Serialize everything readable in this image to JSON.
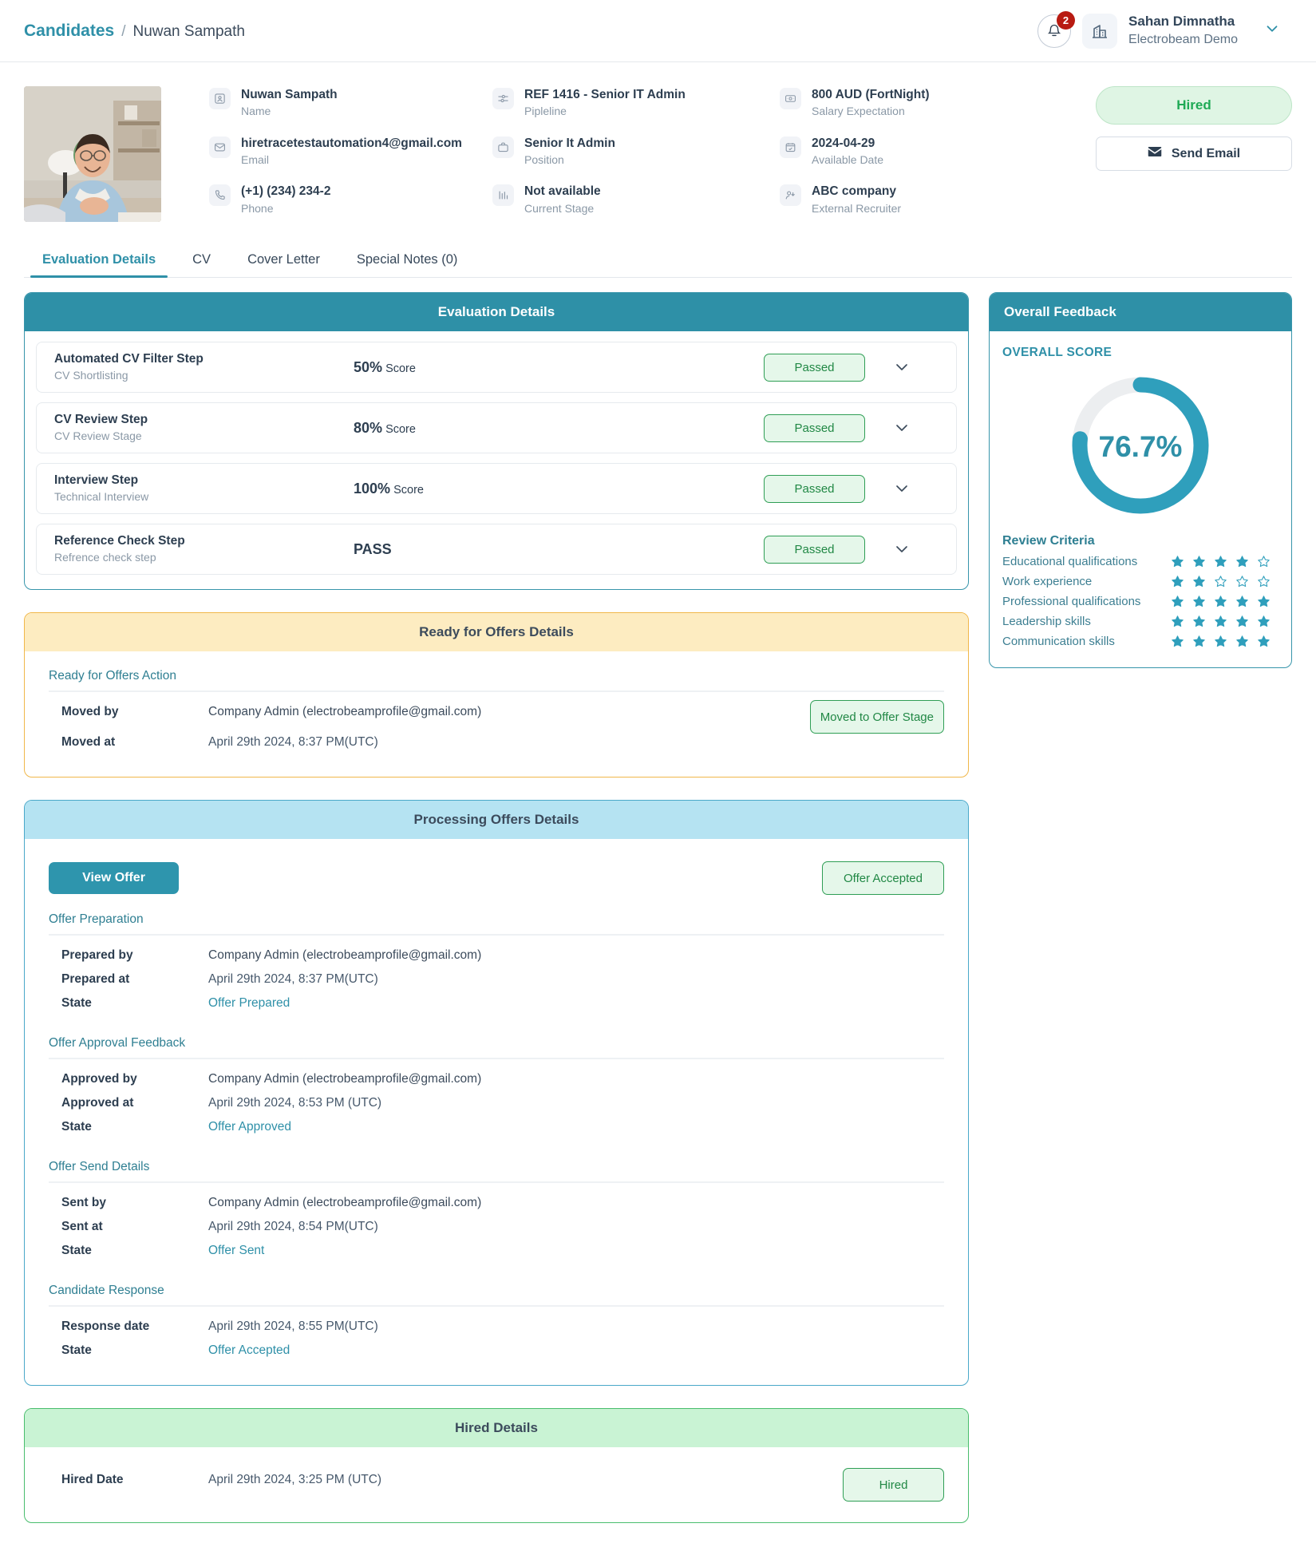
{
  "header": {
    "breadcrumb_root": "Candidates",
    "breadcrumb_sep": "/",
    "breadcrumb_current": "Nuwan Sampath",
    "notification_count": "2",
    "user_name": "Sahan Dimnatha",
    "user_org": "Electrobeam Demo"
  },
  "profile": {
    "fields_col1": [
      {
        "icon": "user-icon",
        "value": "Nuwan Sampath",
        "label": "Name"
      },
      {
        "icon": "email-icon",
        "value": "hiretracetestautomation4@gmail.com",
        "label": "Email"
      },
      {
        "icon": "phone-icon",
        "value": "(+1) (234) 234-2",
        "label": "Phone"
      }
    ],
    "fields_col2": [
      {
        "icon": "pipeline-icon",
        "value": "REF 1416 - Senior IT Admin",
        "label": "Pipleline"
      },
      {
        "icon": "briefcase-icon",
        "value": "Senior It Admin",
        "label": "Position"
      },
      {
        "icon": "chart-icon",
        "value": "Not available",
        "label": "Current Stage"
      }
    ],
    "fields_col3": [
      {
        "icon": "money-icon",
        "value": "800 AUD (FortNight)",
        "label": "Salary Expectation"
      },
      {
        "icon": "calendar-icon",
        "value": "2024-04-29",
        "label": "Available Date"
      },
      {
        "icon": "recruiter-icon",
        "value": "ABC company",
        "label": "External Recruiter"
      }
    ],
    "status_pill": "Hired",
    "send_email_label": "Send Email"
  },
  "tabs": [
    {
      "label": "Evaluation Details",
      "active": true
    },
    {
      "label": "CV",
      "active": false
    },
    {
      "label": "Cover Letter",
      "active": false
    },
    {
      "label": "Special Notes (0)",
      "active": false
    }
  ],
  "evaluation": {
    "title": "Evaluation Details",
    "rows": [
      {
        "title": "Automated CV Filter Step",
        "subtitle": "CV Shortlisting",
        "score_num": "50%",
        "score_word": "Score",
        "status": "Passed"
      },
      {
        "title": "CV Review Step",
        "subtitle": "CV Review Stage",
        "score_num": "80%",
        "score_word": "Score",
        "status": "Passed"
      },
      {
        "title": "Interview Step",
        "subtitle": "Technical Interview",
        "score_num": "100%",
        "score_word": "Score",
        "status": "Passed"
      },
      {
        "title": "Reference Check Step",
        "subtitle": "Refrence check step",
        "score_num": "PASS",
        "score_word": "",
        "status": "Passed"
      }
    ]
  },
  "ready_offers": {
    "title": "Ready for Offers Details",
    "section_label": "Ready for Offers Action",
    "moved_by_key": "Moved by",
    "moved_by_value": "Company Admin (electrobeamprofile@gmail.com)",
    "moved_at_key": "Moved at",
    "moved_at_value": "April 29th 2024, 8:37 PM(UTC)",
    "badge": "Moved to Offer Stage"
  },
  "processing_offers": {
    "title": "Processing Offers Details",
    "view_offer_label": "View Offer",
    "badge": "Offer Accepted",
    "sections": [
      {
        "label": "Offer Preparation",
        "rows": [
          {
            "k": "Prepared by",
            "v": "Company Admin (electrobeamprofile@gmail.com)",
            "style": "plain"
          },
          {
            "k": "Prepared at",
            "v": "April 29th 2024, 8:37 PM(UTC)",
            "style": "muted"
          },
          {
            "k": "State",
            "v": "Offer Prepared",
            "style": "link"
          }
        ]
      },
      {
        "label": "Offer Approval Feedback",
        "rows": [
          {
            "k": "Approved by",
            "v": "Company Admin (electrobeamprofile@gmail.com)",
            "style": "plain"
          },
          {
            "k": "Approved at",
            "v": "April 29th 2024, 8:53 PM (UTC)",
            "style": "muted"
          },
          {
            "k": "State",
            "v": "Offer Approved",
            "style": "link"
          }
        ]
      },
      {
        "label": "Offer Send Details",
        "rows": [
          {
            "k": "Sent by",
            "v": "Company Admin (electrobeamprofile@gmail.com)",
            "style": "plain"
          },
          {
            "k": "Sent at",
            "v": "April 29th 2024, 8:54 PM(UTC)",
            "style": "muted"
          },
          {
            "k": "State",
            "v": "Offer Sent",
            "style": "link"
          }
        ]
      },
      {
        "label": "Candidate Response",
        "rows": [
          {
            "k": "Response date",
            "v": "April 29th 2024, 8:55 PM(UTC)",
            "style": "muted"
          },
          {
            "k": "State",
            "v": "Offer Accepted",
            "style": "link"
          }
        ]
      }
    ]
  },
  "hired": {
    "title": "Hired Details",
    "date_key": "Hired Date",
    "date_value": "April 29th 2024, 3:25 PM (UTC)",
    "badge": "Hired"
  },
  "feedback": {
    "title": "Overall Feedback",
    "score_label": "OVERALL SCORE",
    "score_value": "76.7%",
    "score_percent": 76.7,
    "criteria_title": "Review Criteria",
    "criteria": [
      {
        "name": "Educational qualifications",
        "stars": 4,
        "max": 5
      },
      {
        "name": "Work experience",
        "stars": 2,
        "max": 5
      },
      {
        "name": "Professional qualifications",
        "stars": 5,
        "max": 5
      },
      {
        "name": "Leadership skills",
        "stars": 5,
        "max": 5
      },
      {
        "name": "Communication skills",
        "stars": 5,
        "max": 5
      }
    ]
  },
  "colors": {
    "teal": "#2e90a7",
    "green": "#218845",
    "amber": "#f0b74a",
    "blue": "#4aa8c9",
    "donut_track": "#eceef0"
  }
}
